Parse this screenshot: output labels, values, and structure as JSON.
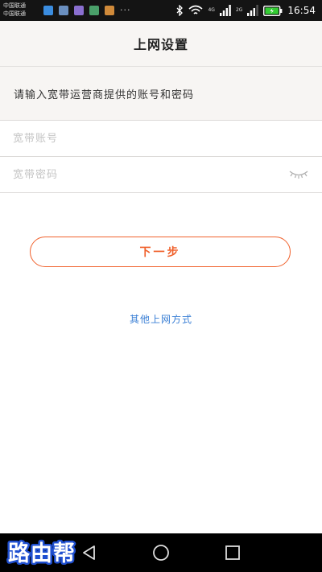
{
  "status_bar": {
    "carrier_1": "中国联通",
    "carrier_2": "中国联通",
    "more_indicator": "···",
    "network_1": "4G",
    "network_2": "2G",
    "time": "16:54",
    "battery_color": "#33cc33"
  },
  "header": {
    "title": "上网设置"
  },
  "instruction": "请输入宽带运营商提供的账号和密码",
  "form": {
    "account": {
      "value": "",
      "placeholder": "宽带账号"
    },
    "password": {
      "value": "",
      "placeholder": "宽带密码",
      "toggle_icon": "eye-closed-icon"
    }
  },
  "actions": {
    "next_label": "下一步",
    "other_methods_label": "其他上网方式"
  },
  "nav": {
    "back_icon": "back-triangle-icon",
    "home_icon": "home-circle-icon",
    "recent_icon": "recent-square-icon"
  },
  "watermark": {
    "text": "路由帮"
  },
  "colors": {
    "accent": "#f0612c",
    "link": "#3a7fd5",
    "header_bg": "#f7f5f3",
    "status_bg": "#141414"
  }
}
